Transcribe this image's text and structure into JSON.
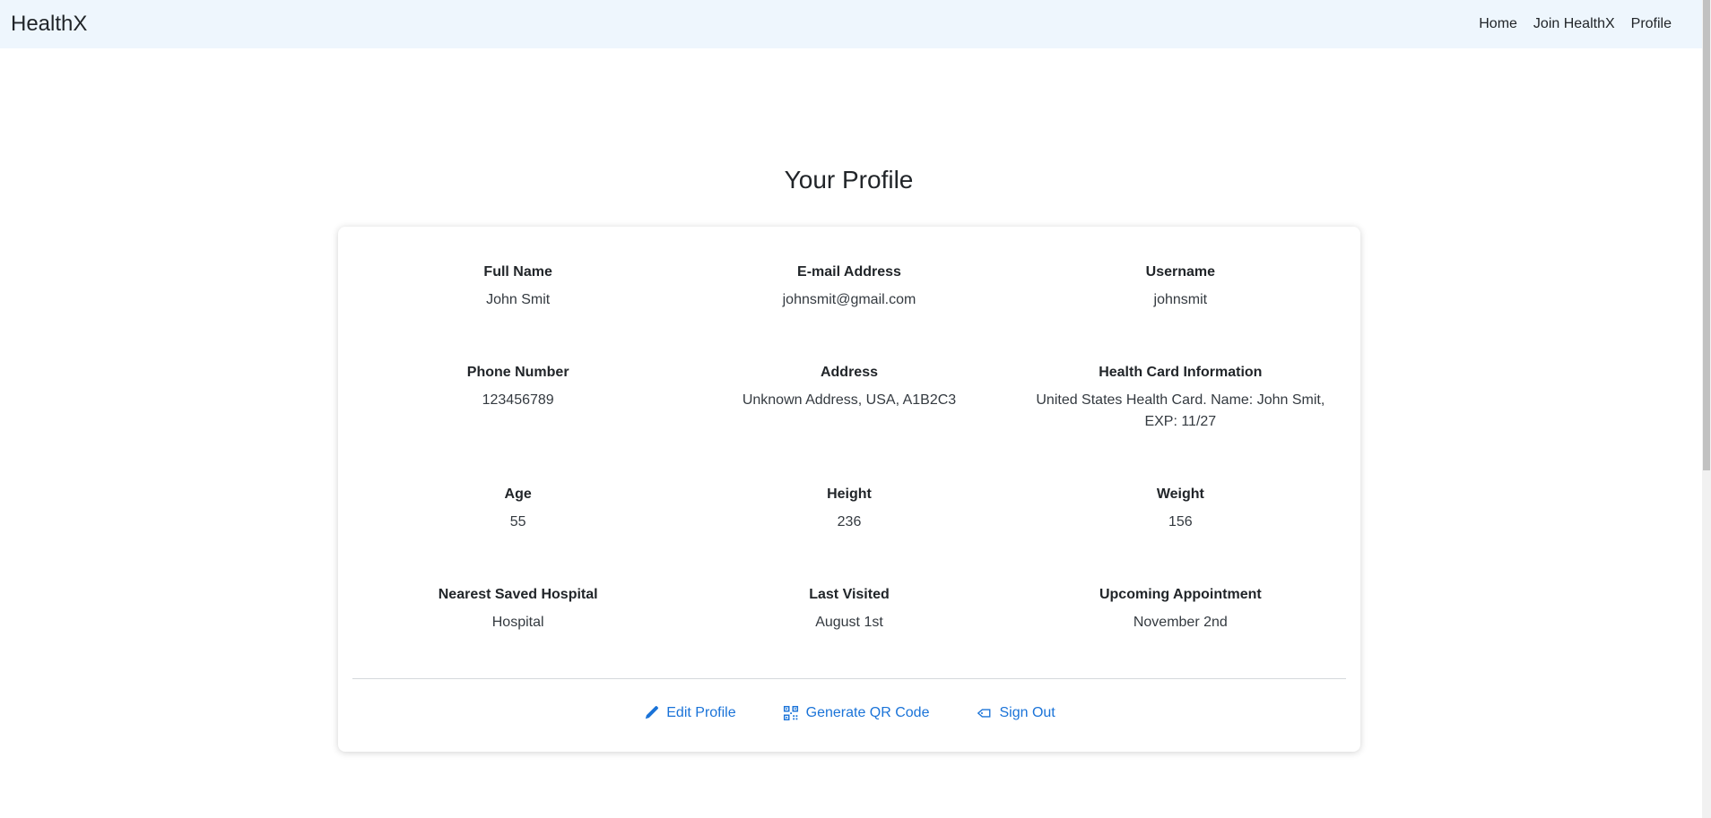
{
  "nav": {
    "brand": "HealthX",
    "links": [
      "Home",
      "Join HealthX",
      "Profile"
    ]
  },
  "page": {
    "title": "Your Profile"
  },
  "profile": {
    "fields": [
      {
        "label": "Full Name",
        "value": "John Smit"
      },
      {
        "label": "E-mail Address",
        "value": "johnsmit@gmail.com"
      },
      {
        "label": "Username",
        "value": "johnsmit"
      },
      {
        "label": "Phone Number",
        "value": "123456789"
      },
      {
        "label": "Address",
        "value": "Unknown Address, USA, A1B2C3"
      },
      {
        "label": "Health Card Information",
        "value": "United States Health Card. Name: John Smit, EXP: 11/27"
      },
      {
        "label": "Age",
        "value": "55"
      },
      {
        "label": "Height",
        "value": "236"
      },
      {
        "label": "Weight",
        "value": "156"
      },
      {
        "label": "Nearest Saved Hospital",
        "value": "Hospital"
      },
      {
        "label": "Last Visited",
        "value": "August 1st"
      },
      {
        "label": "Upcoming Appointment",
        "value": "November 2nd"
      }
    ]
  },
  "actions": {
    "edit": {
      "label": "Edit Profile",
      "icon": "pencil-icon"
    },
    "qr": {
      "label": "Generate QR Code",
      "icon": "qr-code-icon"
    },
    "signout": {
      "label": "Sign Out",
      "icon": "sign-out-icon"
    }
  },
  "colors": {
    "navbar_bg": "#eef6fd",
    "accent": "#1a73d8"
  }
}
